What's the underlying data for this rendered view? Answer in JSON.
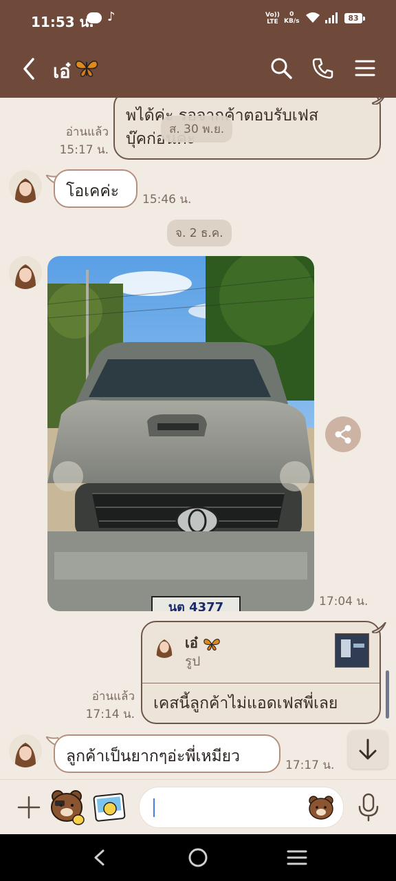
{
  "status_bar": {
    "time": "11:53 น.",
    "network_top": "VoLTE",
    "network_line1": "Vo))",
    "network_line2": "LTE",
    "speed_value": "0",
    "speed_unit": "KB/s",
    "battery": "83"
  },
  "header": {
    "contact_name": "เอ๋",
    "icons": [
      "back-icon",
      "search-icon",
      "phone-icon",
      "menu-icon"
    ]
  },
  "messages": {
    "m1": {
      "text_line1": "พได้ค่ะ รอจากค้าตอบรับเฟส",
      "text_line2": "บุ๊คก่อนค่ะ",
      "read": "อ่านแล้ว",
      "time": "15:17 น."
    },
    "date1": "ส. 30 พ.ย.",
    "m2": {
      "text": "โอเคค่ะ",
      "time": "15:46 น."
    },
    "date2": "จ. 2 ธ.ค.",
    "m3": {
      "type": "photo",
      "time": "17:04 น.",
      "plate": "นต 4377"
    },
    "m4": {
      "quote_name": "เอ๋",
      "quote_sub": "รูป",
      "text": "เคสนี้ลูกค้าไม่แอดเฟสพี่เลย",
      "read": "อ่านแล้ว",
      "time": "17:14 น."
    },
    "m5": {
      "text": "ลูกค้าเป็นยากๆอ่ะพี่เหมียว",
      "time": "17:17 น."
    }
  },
  "input": {
    "placeholder": ""
  },
  "colors": {
    "header_bg": "#6f4a3a",
    "chat_bg": "#f1ebe4",
    "outgoing_bubble": "#ece4d9",
    "date_pill": "#ddd2c6"
  }
}
